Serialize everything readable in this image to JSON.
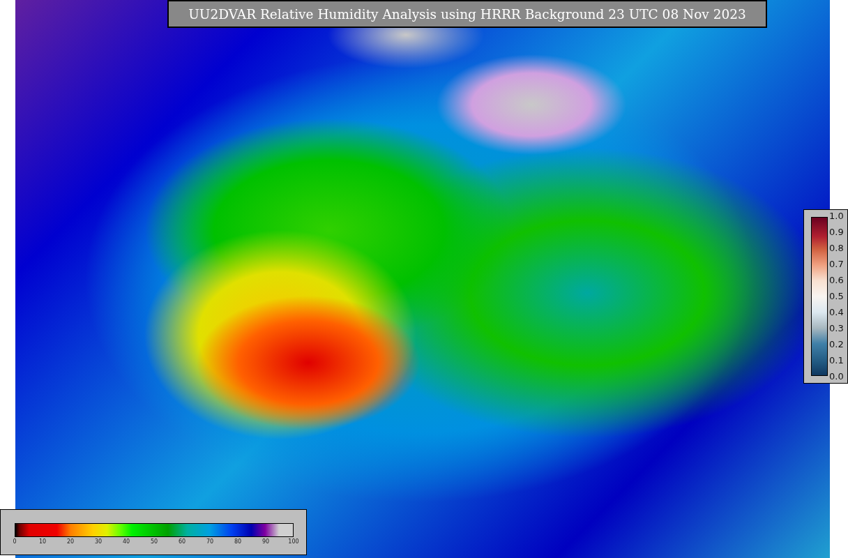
{
  "title": "UU2DVAR Relative Humidity Analysis using HRRR Background 23 UTC 08 Nov 2023",
  "humidity_colorbar": {
    "tick_labels": [
      "0",
      "10",
      "20",
      "30",
      "40",
      "50",
      "60",
      "70",
      "80",
      "90",
      "100"
    ]
  },
  "side_colorbar": {
    "tick_labels": [
      "1.0",
      "0.9",
      "0.8",
      "0.7",
      "0.6",
      "0.5",
      "0.4",
      "0.3",
      "0.2",
      "0.1",
      "0.0"
    ]
  }
}
